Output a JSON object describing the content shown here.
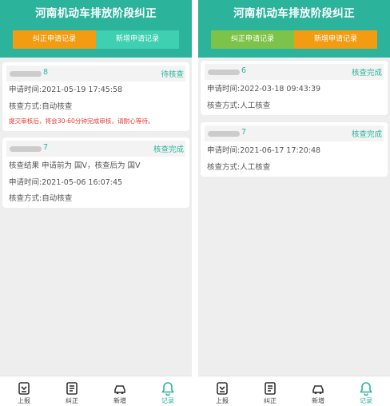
{
  "colors": {
    "accent": "#2bb39c",
    "orange": "#f39c12",
    "teal": "#3fcfb1",
    "green": "#7dc349",
    "warning": "#e53935"
  },
  "left": {
    "title": "河南机动车排放阶段纠正",
    "tabs": [
      {
        "label": "纠正申请记录",
        "active": true
      },
      {
        "label": "新增申请记录",
        "active": false
      }
    ],
    "cards": [
      {
        "id_suffix": "8",
        "status": "待核查",
        "lines": [
          "申请时间:2021-05-19 17:45:58",
          "核查方式:自动核查"
        ],
        "warning": "提交审核后，将会30-60分钟完成审核，请耐心等待。"
      },
      {
        "id_suffix": "7",
        "status": "核查完成",
        "lines": [
          "核查结果   申请前为  国V，核查后为  国V",
          "申请时间:2021-05-06 16:07:45",
          "核查方式:自动核查"
        ]
      }
    ]
  },
  "right": {
    "title": "河南机动车排放阶段纠正",
    "tabs": [
      {
        "label": "纠正申请记录",
        "active": true
      },
      {
        "label": "新增申请记录",
        "active": false
      }
    ],
    "cards": [
      {
        "id_suffix": "6",
        "status": "核查完成",
        "lines": [
          "申请时间:2022-03-18 09:43:39",
          "核查方式:人工核查"
        ]
      },
      {
        "id_suffix": "7",
        "status": "核查完成",
        "lines": [
          "申请时间:2021-06-17 17:20:48",
          "核查方式:人工核查"
        ]
      }
    ]
  },
  "nav": [
    {
      "label": "上报",
      "icon": "report-icon",
      "active": false
    },
    {
      "label": "纠正",
      "icon": "correct-icon",
      "active": false
    },
    {
      "label": "新增",
      "icon": "car-icon",
      "active": false
    },
    {
      "label": "记录",
      "icon": "bell-icon",
      "active": true
    }
  ]
}
